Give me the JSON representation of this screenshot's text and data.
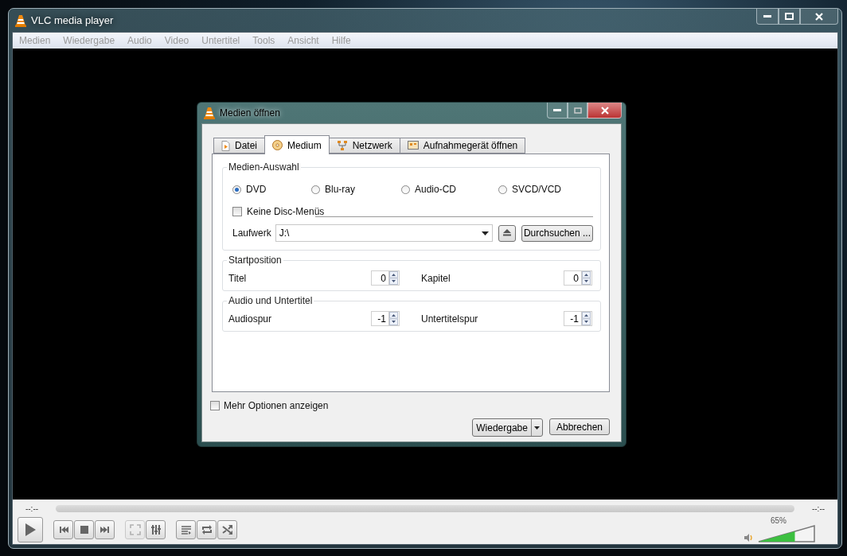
{
  "window": {
    "title": "VLC media player"
  },
  "menu": [
    "Medien",
    "Wiedergabe",
    "Audio",
    "Video",
    "Untertitel",
    "Tools",
    "Ansicht",
    "Hilfe"
  ],
  "dialog": {
    "title": "Medien öffnen",
    "tabs": [
      {
        "label": "Datei",
        "selected": false,
        "kind": "file"
      },
      {
        "label": "Medium",
        "selected": true,
        "kind": "disc"
      },
      {
        "label": "Netzwerk",
        "selected": false,
        "kind": "network"
      },
      {
        "label": "Aufnahmegerät öffnen",
        "selected": false,
        "kind": "capture"
      }
    ],
    "media_selection": {
      "title": "Medien-Auswahl",
      "options": [
        {
          "label": "DVD",
          "selected": true
        },
        {
          "label": "Blu-ray",
          "selected": false
        },
        {
          "label": "Audio-CD",
          "selected": false
        },
        {
          "label": "SVCD/VCD",
          "selected": false
        }
      ],
      "no_disc_menus": {
        "label": "Keine Disc-Menüs",
        "checked": false
      },
      "drive": {
        "label": "Laufwerk",
        "value": "J:\\"
      },
      "browse_button": "Durchsuchen ..."
    },
    "start_position": {
      "title": "Startposition",
      "fields": [
        {
          "label": "Titel",
          "value": "0"
        },
        {
          "label": "Kapitel",
          "value": "0"
        }
      ]
    },
    "audio_subtitles": {
      "title": "Audio und Untertitel",
      "fields": [
        {
          "label": "Audiospur",
          "value": "-1"
        },
        {
          "label": "Untertitelspur",
          "value": "-1"
        }
      ]
    },
    "more_options": {
      "label": "Mehr Optionen anzeigen",
      "checked": false
    },
    "play_button": "Wiedergabe",
    "cancel_button": "Abbrechen"
  },
  "player": {
    "time_elapsed": "--:--",
    "time_total": "--:--",
    "controls": [
      {
        "kind": "prev",
        "disabled": false
      },
      {
        "kind": "stop",
        "disabled": false
      },
      {
        "kind": "next",
        "disabled": false
      },
      {
        "kind": "fullscreen",
        "disabled": true
      },
      {
        "kind": "settings",
        "disabled": false
      },
      {
        "kind": "playlist",
        "disabled": false
      },
      {
        "kind": "loop",
        "disabled": false
      },
      {
        "kind": "shuffle",
        "disabled": false
      }
    ],
    "volume": {
      "level": 0.65,
      "reading": "65%"
    }
  }
}
